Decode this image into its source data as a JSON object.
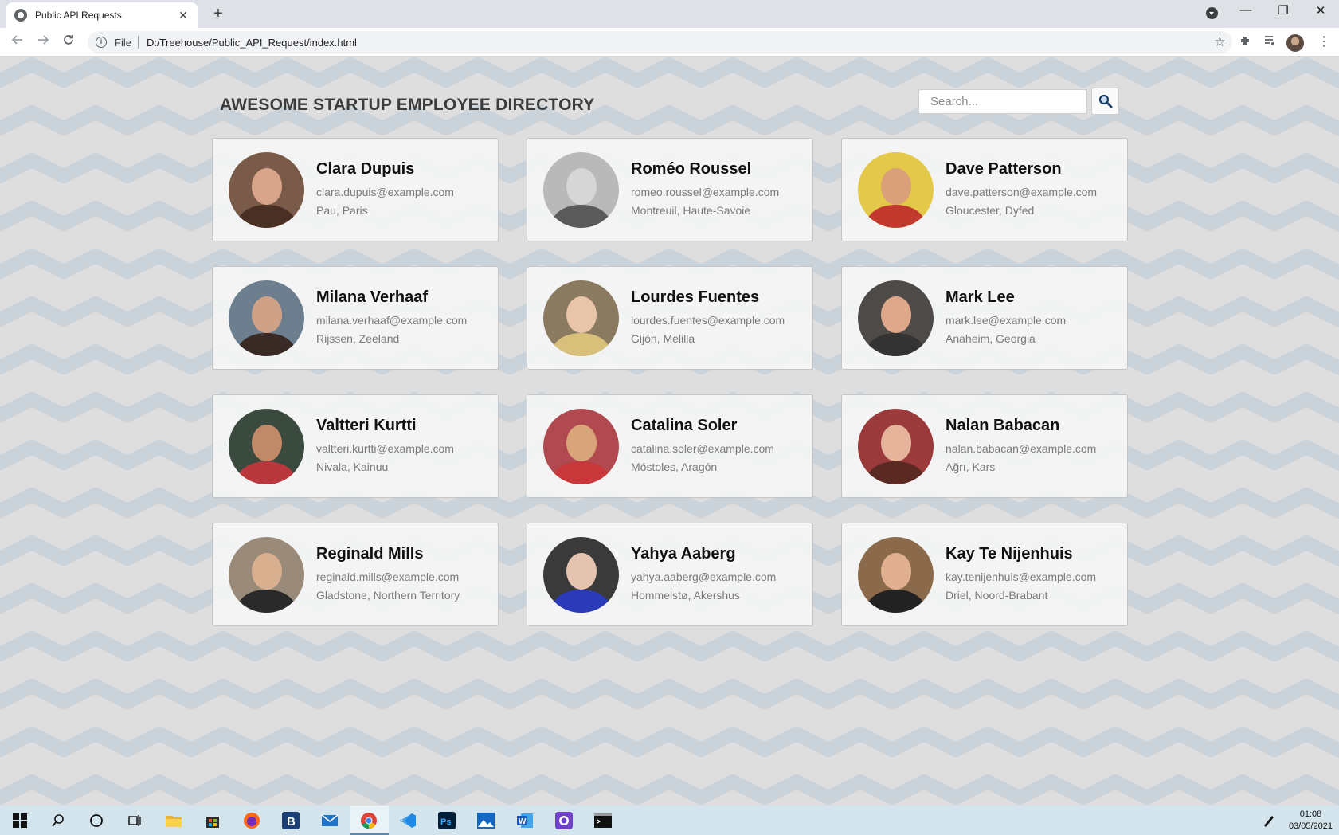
{
  "browser": {
    "tab_title": "Public API Requests",
    "tab_close": "✕",
    "new_tab": "+",
    "omnibox_scheme": "File",
    "omnibox_url": "D:/Treehouse/Public_API_Request/index.html",
    "window_controls": {
      "minimize": "—",
      "restore": "❐",
      "close": "✕"
    }
  },
  "page": {
    "header": "AWESOME STARTUP EMPLOYEE DIRECTORY",
    "search_placeholder": "Search...",
    "background_colors": {
      "light": "#dedede",
      "dark": "#c8d2d8"
    }
  },
  "employees": [
    {
      "name": "Clara Dupuis",
      "email": "clara.dupuis@example.com",
      "location": "Pau, Paris",
      "photo": {
        "bg": "#7a5a48",
        "face": "#d9a58a",
        "body": "#4a2f25"
      }
    },
    {
      "name": "Roméo Roussel",
      "email": "romeo.roussel@example.com",
      "location": "Montreuil, Haute-Savoie",
      "photo": {
        "bg": "#b9b9b9",
        "face": "#d6d6d6",
        "body": "#5a5a5a"
      }
    },
    {
      "name": "Dave Patterson",
      "email": "dave.patterson@example.com",
      "location": "Gloucester, Dyfed",
      "photo": {
        "bg": "#e3c84a",
        "face": "#d9a07a",
        "body": "#c23a2e"
      }
    },
    {
      "name": "Milana Verhaaf",
      "email": "milana.verhaaf@example.com",
      "location": "Rijssen, Zeeland",
      "photo": {
        "bg": "#6d7f8f",
        "face": "#cfa287",
        "body": "#3a2a25"
      }
    },
    {
      "name": "Lourdes Fuentes",
      "email": "lourdes.fuentes@example.com",
      "location": "Gijón, Melilla",
      "photo": {
        "bg": "#8a7a60",
        "face": "#e8c4a8",
        "body": "#d8c07a"
      }
    },
    {
      "name": "Mark Lee",
      "email": "mark.lee@example.com",
      "location": "Anaheim, Georgia",
      "photo": {
        "bg": "#4e4a48",
        "face": "#e0a88a",
        "body": "#333"
      }
    },
    {
      "name": "Valtteri Kurtti",
      "email": "valtteri.kurtti@example.com",
      "location": "Nivala, Kainuu",
      "photo": {
        "bg": "#3a4a3e",
        "face": "#c08a68",
        "body": "#b8383e"
      }
    },
    {
      "name": "Catalina Soler",
      "email": "catalina.soler@example.com",
      "location": "Móstoles, Aragón",
      "photo": {
        "bg": "#b04a50",
        "face": "#d9a47a",
        "body": "#c8383a"
      }
    },
    {
      "name": "Nalan Babacan",
      "email": "nalan.babacan@example.com",
      "location": "Ağrı, Kars",
      "photo": {
        "bg": "#9a3a3a",
        "face": "#e6b49a",
        "body": "#5a2a22"
      }
    },
    {
      "name": "Reginald Mills",
      "email": "reginald.mills@example.com",
      "location": "Gladstone, Northern Territory",
      "photo": {
        "bg": "#9a8a7a",
        "face": "#d8b090",
        "body": "#2a2a2a"
      }
    },
    {
      "name": "Yahya Aaberg",
      "email": "yahya.aaberg@example.com",
      "location": "Hommelstø, Akershus",
      "photo": {
        "bg": "#3a3a3a",
        "face": "#e4c4b0",
        "body": "#2a3ab8"
      }
    },
    {
      "name": "Kay Te Nijenhuis",
      "email": "kay.tenijenhuis@example.com",
      "location": "Driel, Noord-Brabant",
      "photo": {
        "bg": "#8a6a4a",
        "face": "#e0b090",
        "body": "#222"
      }
    }
  ],
  "taskbar": {
    "time": "01:08",
    "date": "03/05/2021"
  }
}
